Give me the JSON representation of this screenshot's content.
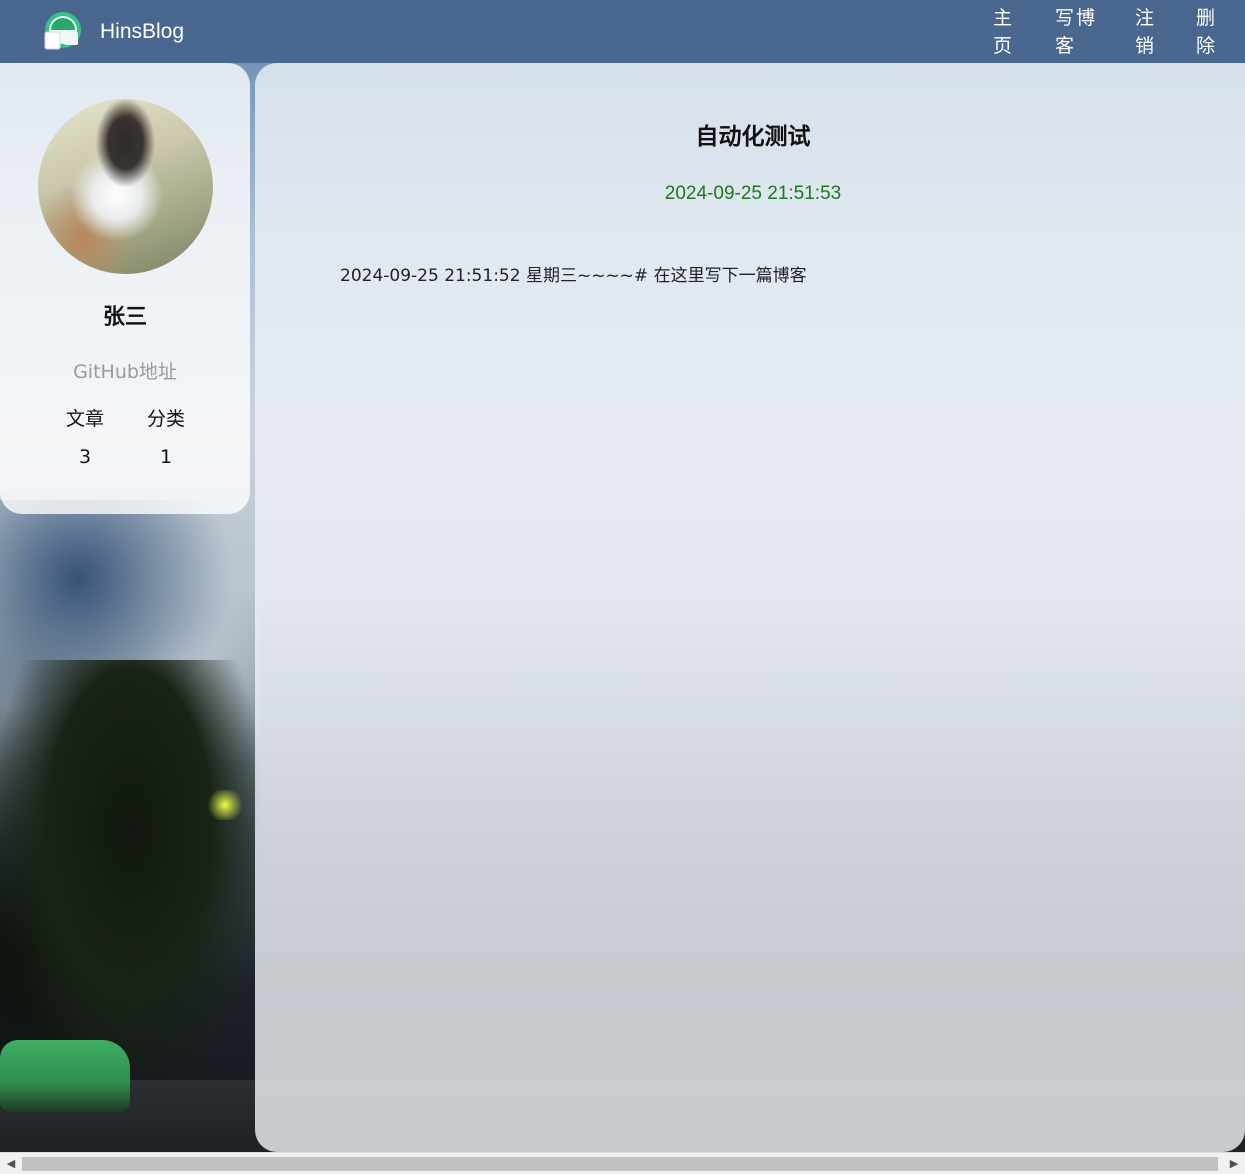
{
  "nav": {
    "site_title": "HinsBlog",
    "links": {
      "home": "主页",
      "write": "写博客",
      "logout": "注销",
      "delete": "删除"
    }
  },
  "profile": {
    "name": "张三",
    "github_link": "GitHub地址",
    "stats": {
      "articles_label": "文章",
      "category_label": "分类",
      "articles_count": "3",
      "category_count": "1"
    }
  },
  "post": {
    "title": "自动化测试",
    "date": "2024-09-25 21:51:53",
    "content": "2024-09-25 21:51:52 星期三~~~~# 在这里写下一篇博客"
  },
  "scrollbar": {
    "left_arrow": "◀",
    "right_arrow": "▶"
  },
  "colors": {
    "nav_bg": "#46648c",
    "date_green": "#1a7a1a",
    "github_gray": "#9a9a9a"
  }
}
